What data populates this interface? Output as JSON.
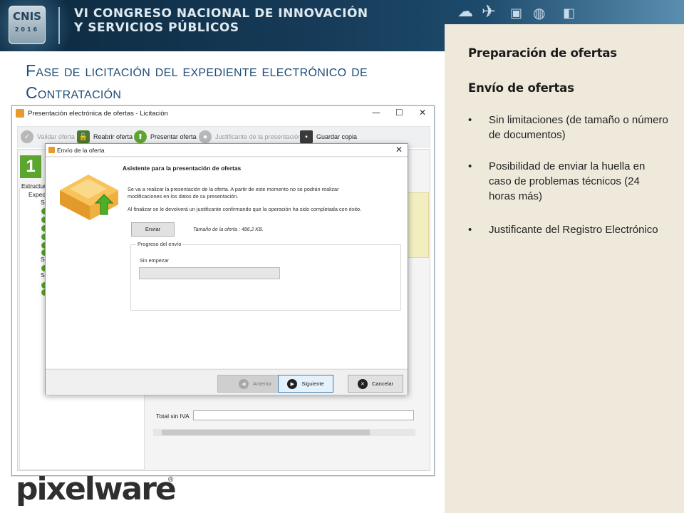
{
  "banner": {
    "logo_text": "CNIS",
    "logo_year": "2016",
    "line1": "VI CONGRESO NACIONAL DE INNOVACIÓN",
    "line2": "Y SERVICIOS PÚBLICOS",
    "icons": [
      "cloud-icon",
      "airplane-icon",
      "bus-icon",
      "car-icon",
      "train-icon"
    ]
  },
  "slide": {
    "title": "Fase de licitación del expediente electrónico de Contratación"
  },
  "right_panel": {
    "heading1": "Preparación de ofertas",
    "heading2": "Envío de ofertas",
    "bullets": [
      "Sin limitaciones (de tamaño o número de documentos)",
      "Posibilidad de enviar la huella en caso de problemas técnicos (24 horas más)",
      "Justificante del Registro Electrónico"
    ],
    "bullet_symbol": "•"
  },
  "bg_window": {
    "title": "Presentación electrónica de ofertas - Licitación",
    "toolbar": {
      "validate": "Validar oferta",
      "reopen": "Reabrir oferta",
      "present": "Presentar oferta",
      "receipt": "Justificante de la presentación",
      "save_copy": "Guardar copia"
    },
    "step_number": "1",
    "structure_label": "Estructura",
    "expediente_label": "Exped",
    "tree_item_prefix": "So",
    "total_label": "Total sin IVA"
  },
  "dialog": {
    "title": "Envío de la oferta",
    "wizard_title": "Asistente para la presentación de ofertas",
    "paragraph1": "Se va a realizar la presentación de la oferta. A partir de este momento no se podrán realizar modificaciones en los datos de su presentación.",
    "paragraph2": "Al finalizar se le devolverá un justificante confirmando que la operación ha sido completada con éxito.",
    "send_button": "Enviar",
    "size_label": "Tamaño de la oferta : 486,2 KB.",
    "progress_group_label": "Progreso del envío",
    "progress_status": "Sin empezar",
    "progress_fraction": 0,
    "back_button": "Anterior",
    "next_button": "Siguiente",
    "cancel_button": "Cancelar"
  },
  "footer_logo": {
    "brand": "pixelware",
    "reg": "®"
  },
  "colors": {
    "banner": "#163a57",
    "right_panel_bg": "#efe9dc",
    "title": "#1f4e79",
    "step_green": "#5ca52e",
    "progress_green": "#06b025"
  }
}
